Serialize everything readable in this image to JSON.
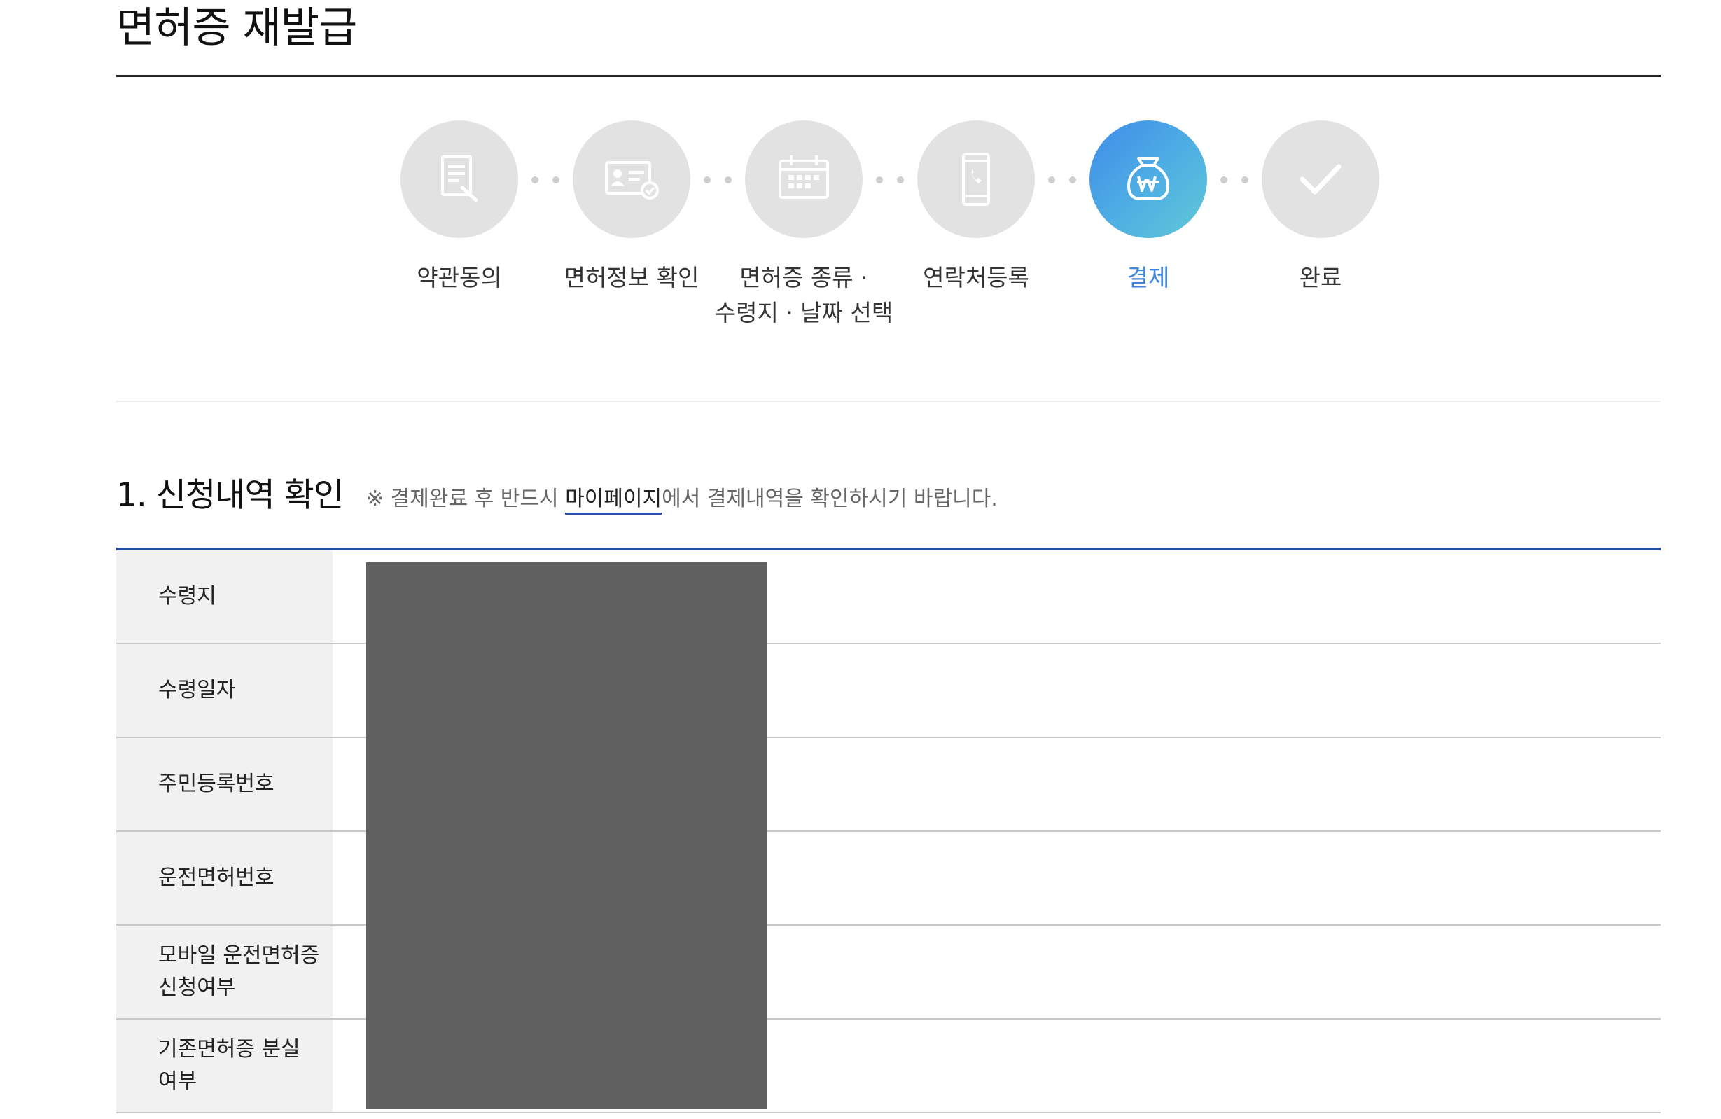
{
  "page": {
    "title": "면허증 재발급"
  },
  "steps": [
    {
      "label": "약관동의",
      "icon": "document-sign-icon",
      "active": false
    },
    {
      "label": "면허정보 확인",
      "icon": "id-card-check-icon",
      "active": false
    },
    {
      "label_line1": "면허증 종류 ·",
      "label_line2": "수령지 · 날짜 선택",
      "icon": "calendar-icon",
      "active": false
    },
    {
      "label": "연락처등록",
      "icon": "mobile-phone-icon",
      "active": false
    },
    {
      "label": "결제",
      "icon": "won-money-bag-icon",
      "active": true
    },
    {
      "label": "완료",
      "icon": "checkmark-icon",
      "active": false
    }
  ],
  "colors": {
    "active_step_gradient_start": "#3f8be9",
    "active_step_gradient_end": "#60c9d6",
    "active_label": "#3e86df",
    "inactive_circle": "#e2e2e2",
    "table_top_border": "#2a4a9e",
    "row_label_bg": "#f1f1f1",
    "redaction": "#616161"
  },
  "section": {
    "title": "1. 신청내역 확인",
    "notice_prefix": "※ 결제완료 후 반드시 ",
    "notice_link": "마이페이지",
    "notice_suffix": "에서 결제내역을 확인하시기 바랍니다."
  },
  "table": {
    "rows": [
      {
        "label": "수령지"
      },
      {
        "label": "수령일자"
      },
      {
        "label": "주민등록번호"
      },
      {
        "label": "운전면허번호"
      },
      {
        "label_line1": "모바일 운전면허증",
        "label_line2": "신청여부"
      },
      {
        "label_line1": "기존면허증 분실",
        "label_line2": "여부"
      }
    ]
  }
}
